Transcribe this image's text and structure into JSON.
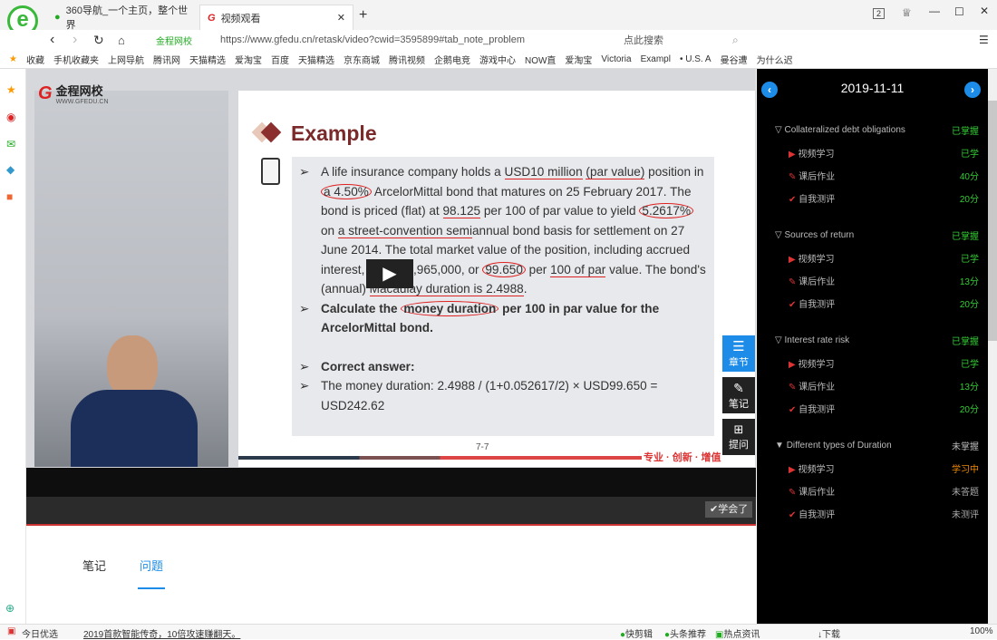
{
  "browser": {
    "tabs": [
      {
        "label": "360导航_一个主页，整个世界"
      },
      {
        "label": "视频观看"
      }
    ],
    "site_label": "金程网校",
    "url": "https://www.gfedu.cn/retask/video?cwid=3595899#tab_note_problem",
    "search_placeholder": "点此搜索",
    "tab_count": "2",
    "bookmarks": [
      "收藏",
      "手机收藏夹",
      "上网导航",
      "腾讯网",
      "天猫精选",
      "爱淘宝",
      "百度",
      "天猫精选",
      "京东商城",
      "腾讯视频",
      "企鹅电竞",
      "游戏中心",
      "NOW直",
      "爱淘宝",
      "Victoria",
      "Exampl",
      "• U.S. A",
      "曼谷遭",
      "为什么迟"
    ]
  },
  "logo": {
    "name": "金程网校",
    "sub": "WWW.GFEDU.CN"
  },
  "slide": {
    "title": "Example",
    "page": "7-7",
    "slogan": "专业 · 创新 · 增值",
    "p1": [
      "A life insurance company holds a ",
      "USD10 million",
      " ",
      "(par value)",
      " position in ",
      "a 4.50%",
      " ArcelorMittal bond that matures on 25 February 2017. The bond is priced (flat) at ",
      "98.125",
      " per 100 of par value to yield ",
      "5.2617%",
      " on ",
      "a street-convention semi",
      "annual bond basis for settlement on 27 June 2014. The total market value of the position, including accrued interest, is USD9,965,000, or ",
      "99.650",
      " per ",
      "100 of par",
      " value. The bond's (annual) ",
      "Macaulay duration is 2.4988",
      "."
    ],
    "q": [
      "Calculate the ",
      "money duration",
      " per 100 in par value for the ArcelorMittal bond."
    ],
    "answer_label": "Correct answer:",
    "answer": "The money duration: 2.4988 / (1+0.052617/2) × USD99.650 = USD242.62"
  },
  "side_buttons": {
    "chapter": "章节",
    "notes": "笔记",
    "ask": "提问"
  },
  "learned_button": "学会了",
  "bottom_tabs": {
    "notes": "笔记",
    "questions": "问题"
  },
  "panel": {
    "date": "2019-11-11",
    "sections": [
      {
        "title": "Collateralized debt obligations",
        "status": "已掌握",
        "items": [
          {
            "label": "视频学习",
            "value": "已学"
          },
          {
            "label": "课后作业",
            "value": "40分"
          },
          {
            "label": "自我测评",
            "value": "20分"
          }
        ]
      },
      {
        "title": "Sources of return",
        "status": "已掌握",
        "items": [
          {
            "label": "视频学习",
            "value": "已学"
          },
          {
            "label": "课后作业",
            "value": "13分"
          },
          {
            "label": "自我测评",
            "value": "20分"
          }
        ]
      },
      {
        "title": "Interest rate risk",
        "status": "已掌握",
        "items": [
          {
            "label": "视频学习",
            "value": "已学"
          },
          {
            "label": "课后作业",
            "value": "13分"
          },
          {
            "label": "自我测评",
            "value": "20分"
          }
        ]
      },
      {
        "title": "Different types of Duration",
        "status": "未掌握",
        "items": [
          {
            "label": "视频学习",
            "value": "学习中"
          },
          {
            "label": "课后作业",
            "value": "未答题"
          },
          {
            "label": "自我测评",
            "value": "未测评"
          }
        ]
      }
    ]
  },
  "status": {
    "today": "今日优选",
    "news": "2019首款智能传奇，10倍攻速赚翻天。",
    "items": [
      "快剪辑",
      "头条推荐",
      "热点资讯",
      "下载"
    ],
    "zoom": "100%"
  }
}
